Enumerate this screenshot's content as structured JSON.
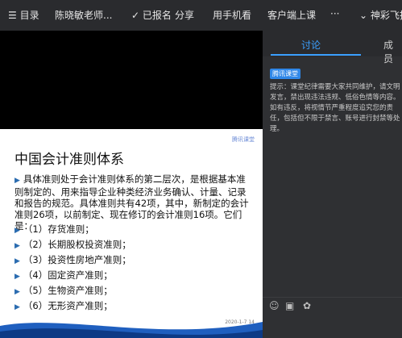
{
  "topbar": {
    "menu_label": "目录",
    "teacher": "陈晓敏老师...",
    "signup": "已报名",
    "share": "分享",
    "phone": "用手机看",
    "client": "客户端上课",
    "more": "···",
    "brand": "神彩飞扬"
  },
  "slide": {
    "logo": "腾讯课堂",
    "title": "中国会计准则体系",
    "paragraph": "具体准则处于会计准则体系的第二层次，是根据基本准则制定的、用来指导企业种类经济业务确认、计量、记录和报告的规范。具体准则共有42项，其中，新制定的会计准则26项，以前制定、现在修订的会计准则16项。它们是：",
    "items": [
      "（1）存货准则；",
      "（2）长期股权投资准则；",
      "（3）投资性房地产准则；",
      "（4）固定资产准则；",
      "（5）生物资产准则；",
      "（6）无形资产准则；"
    ],
    "pager": "2020-1-7          14"
  },
  "panel": {
    "tab_discussion": "讨论",
    "tab_members": "成员",
    "badge": "腾讯课堂",
    "notice": "提示：课堂纪律需要大家共同维护，请文明发言，禁出现违法违规、低俗色情等内容。如有违反，将视情节严重程度追究您的责任，包括但不限于禁言、账号进行封禁等处理。"
  },
  "colors": {
    "accent": "#3ba0ff",
    "badge": "#2f87e8"
  }
}
